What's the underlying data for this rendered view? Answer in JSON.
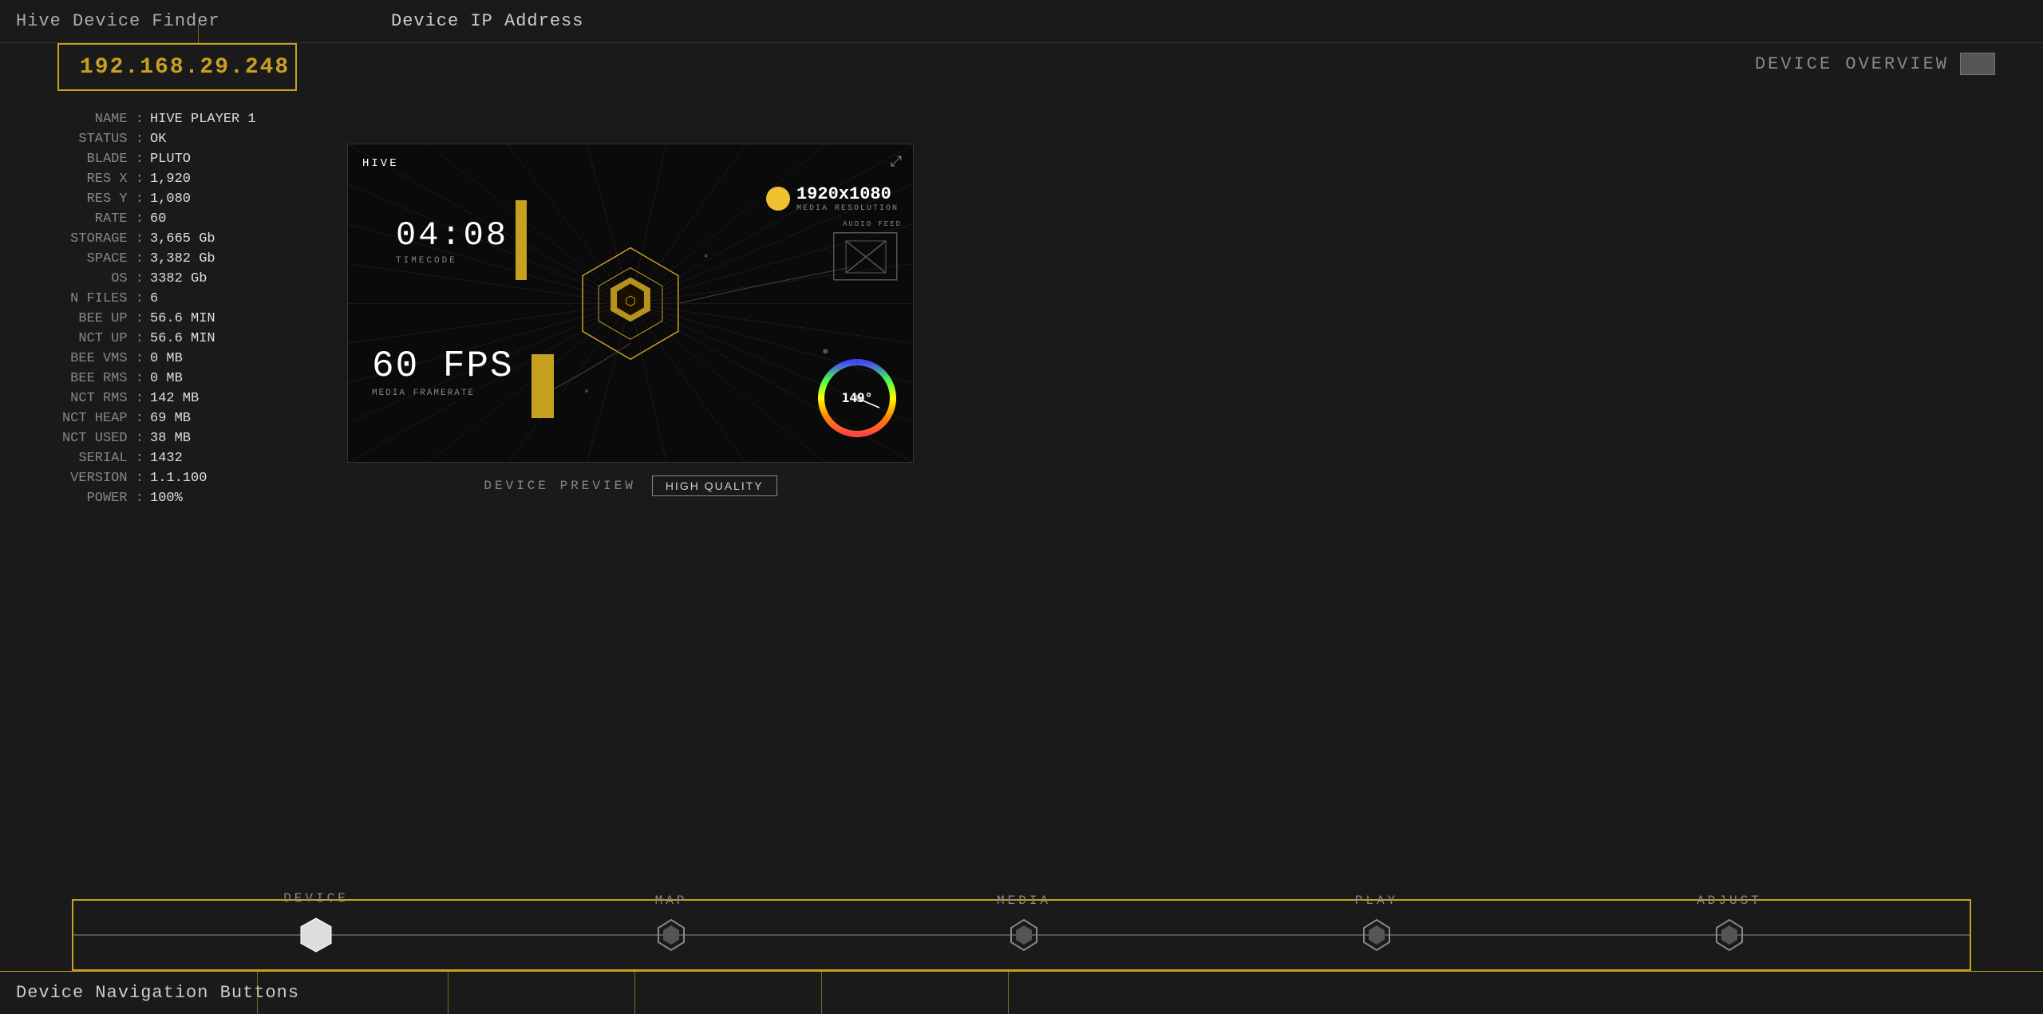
{
  "header": {
    "title": "Hive Device Finder",
    "ip_label": "Device IP Address"
  },
  "device": {
    "ip": "192.168.29.248",
    "overview_label": "DEVICE OVERVIEW",
    "name": "HIVE PLAYER 1",
    "status": "OK",
    "blade": "PLUTO",
    "res_x": "1,920",
    "res_y": "1,080",
    "rate": "60",
    "storage": "3,665 Gb",
    "space": "3,382 Gb",
    "os": "3382 Gb",
    "n_files": "6",
    "bee_up": "56.6 MIN",
    "nct_up": "56.6 MIN",
    "bee_vms": "0 MB",
    "bee_rms": "0 MB",
    "nct_rms": "142 MB",
    "nct_heap": "69 MB",
    "nct_used": "38 MB",
    "serial": "1432",
    "version": "1.1.100",
    "power": "100%"
  },
  "preview": {
    "hive_label": "HIVE",
    "timecode": "04:08",
    "timecode_label": "TIMECODE",
    "fps": "60 FPS",
    "fps_label": "MEDIA FRAMERATE",
    "resolution": "1920x1080",
    "resolution_label": "MEDIA RESOLUTION",
    "audio_label": "AUDIO FEED",
    "dial_value": "149°",
    "preview_label": "DEVICE PREVIEW",
    "quality_btn": "HIGH QUALITY"
  },
  "nav": {
    "items": [
      {
        "label": "DEVICE",
        "active": true
      },
      {
        "label": "MAP",
        "active": false
      },
      {
        "label": "MEDIA",
        "active": false
      },
      {
        "label": "PLAY",
        "active": false
      },
      {
        "label": "ADJUST",
        "active": false
      }
    ]
  },
  "info_rows": [
    {
      "label": "NAME :",
      "value": "HIVE PLAYER 1"
    },
    {
      "label": "STATUS :",
      "value": "OK"
    },
    {
      "label": "BLADE :",
      "value": "PLUTO"
    },
    {
      "label": "RES X :",
      "value": "1,920"
    },
    {
      "label": "RES Y :",
      "value": "1,080"
    },
    {
      "label": "RATE :",
      "value": "60"
    },
    {
      "label": "STORAGE :",
      "value": "3,665 Gb"
    },
    {
      "label": "SPACE :",
      "value": "3,382 Gb"
    },
    {
      "label": "OS :",
      "value": "3382 Gb"
    },
    {
      "label": "N FILES :",
      "value": "6"
    },
    {
      "label": "BEE UP :",
      "value": "56.6 MIN"
    },
    {
      "label": "NCT UP :",
      "value": "56.6 MIN"
    },
    {
      "label": "BEE VMS :",
      "value": "0 MB"
    },
    {
      "label": "BEE RMS :",
      "value": "0 MB"
    },
    {
      "label": "NCT RMS :",
      "value": "142 MB"
    },
    {
      "label": "NCT HEAP :",
      "value": "69 MB"
    },
    {
      "label": "NCT USED :",
      "value": "38 MB"
    },
    {
      "label": "SERIAL :",
      "value": "1432"
    },
    {
      "label": "VERSION :",
      "value": "1.1.100"
    },
    {
      "label": "POWER :",
      "value": "100%"
    }
  ],
  "bottom": {
    "label": "Device Navigation Buttons"
  }
}
